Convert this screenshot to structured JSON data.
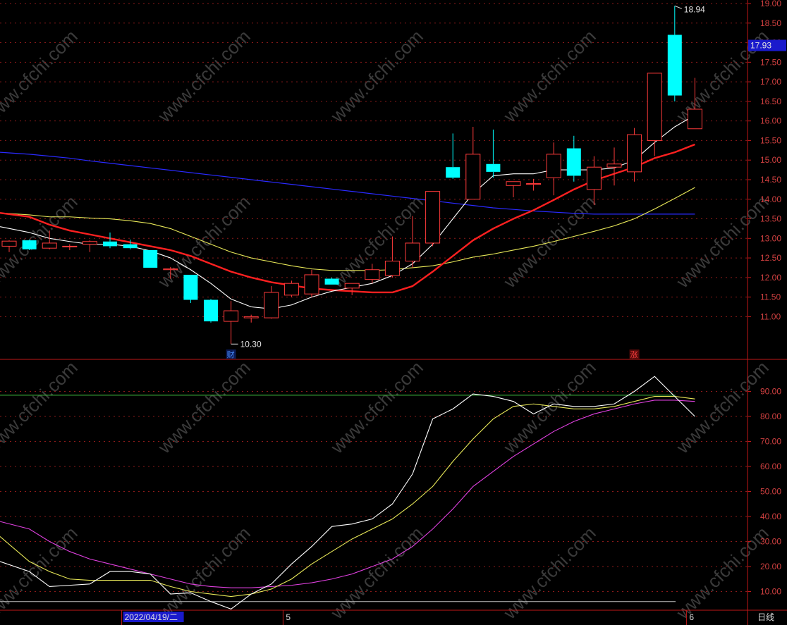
{
  "chart_data": [
    {
      "type": "candlestick",
      "price_axis": {
        "min": 10.3,
        "max": 19.0,
        "ticks": [
          19.0,
          18.5,
          18.0,
          17.5,
          17.0,
          16.5,
          16.0,
          15.5,
          15.0,
          14.5,
          14.0,
          13.5,
          13.0,
          12.5,
          12.0,
          11.5,
          11.0
        ]
      },
      "tick_labels": [
        "19.00",
        "18.50",
        "18.00",
        "17.50",
        "17.00",
        "16.50",
        "16.00",
        "15.50",
        "15.00",
        "14.50",
        "14.00",
        "13.50",
        "13.00",
        "12.50",
        "12.00",
        "11.50",
        "11.00"
      ],
      "current_price_label": "17.93",
      "current_price": 17.93,
      "high_annotation": "18.94",
      "high_value": 18.94,
      "low_annotation": "10.30",
      "low_value": 10.3,
      "candles": [
        {
          "o": 12.8,
          "h": 12.95,
          "l": 12.65,
          "c": 12.93
        },
        {
          "o": 12.95,
          "h": 12.97,
          "l": 12.7,
          "c": 12.72
        },
        {
          "o": 12.75,
          "h": 13.2,
          "l": 12.72,
          "c": 12.88
        },
        {
          "o": 12.8,
          "h": 12.85,
          "l": 12.7,
          "c": 12.8
        },
        {
          "o": 12.85,
          "h": 12.95,
          "l": 12.65,
          "c": 12.92
        },
        {
          "o": 12.92,
          "h": 13.15,
          "l": 12.75,
          "c": 12.8
        },
        {
          "o": 12.85,
          "h": 12.97,
          "l": 12.72,
          "c": 12.75
        },
        {
          "o": 12.7,
          "h": 12.7,
          "l": 12.25,
          "c": 12.25
        },
        {
          "o": 12.2,
          "h": 12.27,
          "l": 11.97,
          "c": 12.22
        },
        {
          "o": 12.07,
          "h": 12.07,
          "l": 11.35,
          "c": 11.43
        },
        {
          "o": 11.43,
          "h": 11.45,
          "l": 10.85,
          "c": 10.88
        },
        {
          "o": 10.88,
          "h": 11.4,
          "l": 10.3,
          "c": 11.15
        },
        {
          "o": 10.97,
          "h": 11.05,
          "l": 10.85,
          "c": 11.0
        },
        {
          "o": 10.97,
          "h": 11.78,
          "l": 10.95,
          "c": 11.62
        },
        {
          "o": 11.55,
          "h": 11.92,
          "l": 11.5,
          "c": 11.85
        },
        {
          "o": 11.58,
          "h": 12.2,
          "l": 11.5,
          "c": 12.07
        },
        {
          "o": 11.97,
          "h": 12.0,
          "l": 11.82,
          "c": 11.82
        },
        {
          "o": 11.73,
          "h": 11.85,
          "l": 11.55,
          "c": 11.85
        },
        {
          "o": 11.95,
          "h": 12.35,
          "l": 11.85,
          "c": 12.2
        },
        {
          "o": 12.05,
          "h": 13.05,
          "l": 12.0,
          "c": 12.42
        },
        {
          "o": 12.42,
          "h": 13.57,
          "l": 12.25,
          "c": 12.88
        },
        {
          "o": 12.88,
          "h": 14.2,
          "l": 12.8,
          "c": 14.2
        },
        {
          "o": 14.82,
          "h": 15.68,
          "l": 14.52,
          "c": 14.55
        },
        {
          "o": 14.0,
          "h": 15.85,
          "l": 14.0,
          "c": 15.15
        },
        {
          "o": 14.9,
          "h": 15.78,
          "l": 14.55,
          "c": 14.7
        },
        {
          "o": 14.35,
          "h": 14.45,
          "l": 14.05,
          "c": 14.45
        },
        {
          "o": 14.38,
          "h": 14.52,
          "l": 14.22,
          "c": 14.4
        },
        {
          "o": 14.55,
          "h": 15.45,
          "l": 14.1,
          "c": 15.15
        },
        {
          "o": 15.3,
          "h": 15.62,
          "l": 14.45,
          "c": 14.6
        },
        {
          "o": 14.25,
          "h": 15.1,
          "l": 13.85,
          "c": 14.82
        },
        {
          "o": 14.82,
          "h": 15.32,
          "l": 14.35,
          "c": 14.9
        },
        {
          "o": 14.7,
          "h": 15.82,
          "l": 14.45,
          "c": 15.65
        },
        {
          "o": 15.5,
          "h": 17.22,
          "l": 15.1,
          "c": 17.22
        },
        {
          "o": 18.2,
          "h": 18.94,
          "l": 16.5,
          "c": 16.65
        },
        {
          "o": 15.8,
          "h": 17.1,
          "l": 15.8,
          "c": 16.3
        }
      ],
      "ma_white": [
        13.3,
        13.15,
        13.0,
        12.92,
        12.85,
        12.85,
        12.8,
        12.68,
        12.5,
        12.2,
        11.85,
        11.45,
        11.25,
        11.2,
        11.3,
        11.5,
        11.65,
        11.75,
        11.85,
        12.05,
        12.35,
        12.85,
        13.5,
        14.15,
        14.6,
        14.65,
        14.65,
        14.75,
        14.75,
        14.75,
        14.8,
        15.0,
        15.45,
        15.85,
        16.15
      ],
      "ma_red": [
        13.65,
        13.55,
        13.35,
        13.2,
        13.1,
        13.0,
        12.9,
        12.8,
        12.7,
        12.55,
        12.35,
        12.15,
        12.0,
        11.88,
        11.8,
        11.72,
        11.68,
        11.65,
        11.62,
        11.62,
        11.78,
        12.15,
        12.55,
        12.95,
        13.25,
        13.5,
        13.72,
        13.98,
        14.25,
        14.48,
        14.65,
        14.82,
        15.05,
        15.2,
        15.4
      ],
      "ma_yellow": [
        13.65,
        13.6,
        13.55,
        13.55,
        13.52,
        13.5,
        13.45,
        13.38,
        13.25,
        13.05,
        12.85,
        12.65,
        12.5,
        12.4,
        12.3,
        12.22,
        12.18,
        12.18,
        12.18,
        12.2,
        12.25,
        12.3,
        12.4,
        12.52,
        12.6,
        12.7,
        12.8,
        12.92,
        13.05,
        13.18,
        13.32,
        13.5,
        13.75,
        14.02,
        14.3
      ],
      "ma_blue": [
        15.2,
        15.15,
        15.1,
        15.05,
        14.98,
        14.92,
        14.86,
        14.8,
        14.74,
        14.68,
        14.62,
        14.56,
        14.5,
        14.44,
        14.38,
        14.32,
        14.26,
        14.2,
        14.14,
        14.08,
        14.02,
        13.96,
        13.9,
        13.84,
        13.78,
        13.74,
        13.7,
        13.67,
        13.64,
        13.62,
        13.62,
        13.62,
        13.62,
        13.62,
        13.62
      ],
      "markers": [
        {
          "label": "财",
          "index": 11,
          "color": "#4a8fff"
        },
        {
          "label": "涨",
          "index": 31,
          "color": "#ff4040"
        }
      ]
    },
    {
      "type": "line",
      "y_axis": {
        "min": 0,
        "max": 100,
        "ticks": [
          90,
          80,
          70,
          60,
          50,
          40,
          30,
          20,
          10
        ]
      },
      "tick_labels": [
        "90.00",
        "80.00",
        "70.00",
        "60.00",
        "50.00",
        "40.00",
        "30.00",
        "20.00",
        "10.00"
      ],
      "reference_lines": [
        {
          "value": 88.5,
          "color": "#40c040"
        },
        {
          "value": 6,
          "color": "#c0c0c0"
        }
      ],
      "series": [
        {
          "color": "#ffffff",
          "values": [
            22,
            18,
            12,
            12.5,
            13,
            18,
            18,
            17,
            9,
            9.5,
            6,
            3,
            9,
            13,
            21,
            28,
            36,
            37,
            39,
            45,
            57,
            79,
            83,
            89,
            88,
            86,
            81,
            85,
            84,
            84,
            85,
            90,
            96,
            88,
            80
          ]
        },
        {
          "color": "#e8e858",
          "values": [
            32,
            22,
            18,
            15,
            14.5,
            14.5,
            14.5,
            14.5,
            12,
            10,
            9,
            8,
            9,
            11,
            15,
            21,
            26,
            31,
            35,
            39,
            45,
            52,
            62,
            71,
            79,
            84,
            85,
            84,
            83,
            83,
            84,
            86,
            88,
            88,
            87
          ]
        },
        {
          "color": "#e040e0",
          "values": [
            38,
            35,
            30,
            26,
            23,
            21,
            19,
            17,
            15,
            13,
            12,
            11.5,
            11.5,
            12,
            12.5,
            13.5,
            15,
            17,
            20,
            23,
            28,
            35,
            43,
            52,
            58,
            64,
            69,
            74,
            78,
            81,
            83,
            85,
            86.5,
            86.5,
            86
          ]
        }
      ]
    }
  ],
  "x_axis": {
    "labels": [
      {
        "text": "2022/04/19/二",
        "index": 6,
        "highlight": true
      },
      {
        "text": "5",
        "index": 14,
        "highlight": false
      },
      {
        "text": "6",
        "index": 34,
        "highlight": false
      }
    ],
    "period_label": "日线"
  },
  "watermark": "www.cfchi.com",
  "colors": {
    "up": "#ff3b3b",
    "down": "#00ffff",
    "axis": "#c01818",
    "grid": "#8a1a1a"
  }
}
